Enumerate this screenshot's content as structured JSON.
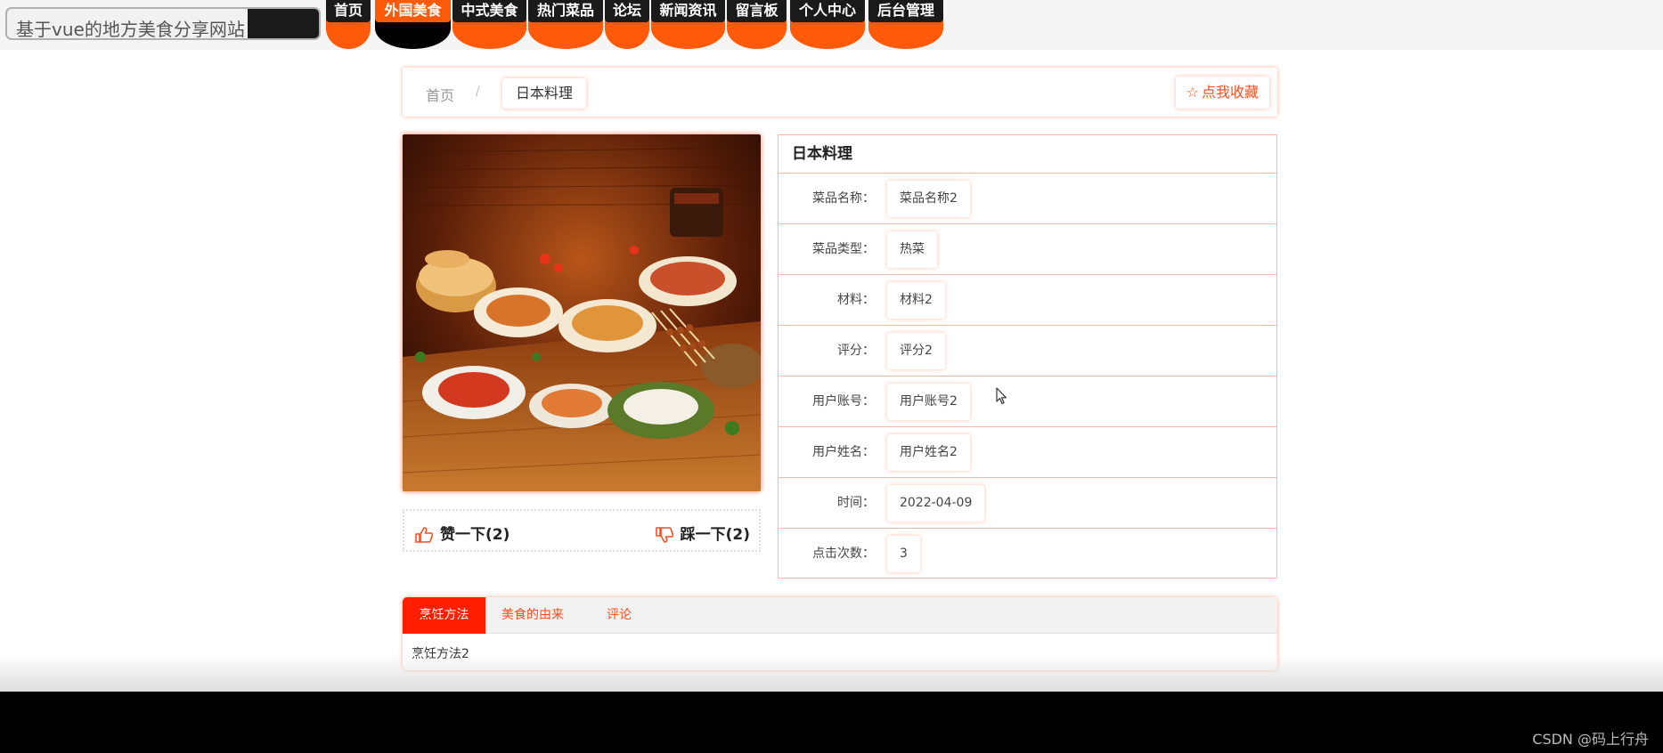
{
  "site": {
    "title": "基于vue的地方美食分享网站"
  },
  "nav": {
    "items": [
      {
        "label": "首页"
      },
      {
        "label": "外国美食"
      },
      {
        "label": "中式美食"
      },
      {
        "label": "热门菜品"
      },
      {
        "label": "论坛"
      },
      {
        "label": "新闻资讯"
      },
      {
        "label": "留言板"
      },
      {
        "label": "个人中心"
      },
      {
        "label": "后台管理"
      }
    ],
    "active_index": 1
  },
  "breadcrumb": {
    "home": "首页",
    "separator": "/",
    "current": "日本料理"
  },
  "favorite": {
    "label": "点我收藏"
  },
  "votes": {
    "like_label": "赞一下(2)",
    "dislike_label": "踩一下(2)"
  },
  "details": {
    "title": "日本料理",
    "rows": [
      {
        "label": "菜品名称：",
        "value": "菜品名称2"
      },
      {
        "label": "菜品类型：",
        "value": "热菜"
      },
      {
        "label": "材料：",
        "value": "材料2"
      },
      {
        "label": "评分：",
        "value": "评分2"
      },
      {
        "label": "用户账号：",
        "value": "用户账号2"
      },
      {
        "label": "用户姓名：",
        "value": "用户姓名2"
      },
      {
        "label": "时间：",
        "value": "2022-04-09"
      },
      {
        "label": "点击次数：",
        "value": "3"
      }
    ]
  },
  "tabs": {
    "items": [
      {
        "label": "烹饪方法"
      },
      {
        "label": "美食的由来"
      },
      {
        "label": "评论"
      }
    ],
    "active_index": 0,
    "content": "烹饪方法2"
  },
  "footer": {
    "watermark": "CSDN @码上行舟"
  },
  "colors": {
    "accent": "#ff5a0a",
    "nav_label_bg": "#1a1a1a",
    "tab_active": "#ff1f00",
    "border": "#f7b8a8"
  },
  "icons": {
    "favorite": "star-outline-icon",
    "like": "thumbs-up-icon",
    "dislike": "thumbs-down-icon"
  }
}
